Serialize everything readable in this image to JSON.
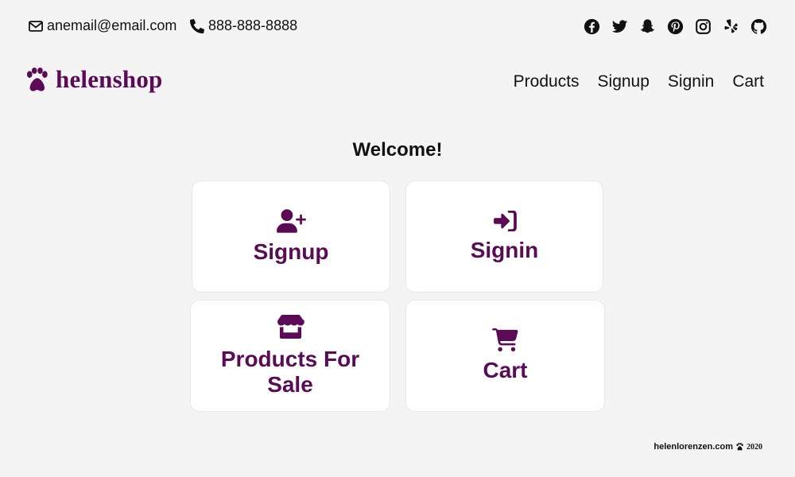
{
  "colors": {
    "brand": "#5b0a56",
    "background": "#f4f4f4",
    "card": "#ffffff",
    "text": "#111111"
  },
  "topbar": {
    "email": "anemail@email.com",
    "phone": "888-888-8888",
    "social_icons": [
      "facebook-icon",
      "twitter-icon",
      "snapchat-icon",
      "pinterest-icon",
      "instagram-icon",
      "yelp-icon",
      "github-icon"
    ]
  },
  "brand": {
    "name": "helenshop",
    "icon": "paw-icon"
  },
  "nav": {
    "items": [
      "Products",
      "Signup",
      "Signin",
      "Cart"
    ]
  },
  "main": {
    "welcome": "Welcome!",
    "cards": [
      {
        "label": "Signup",
        "icon": "user-plus-icon"
      },
      {
        "label": "Signin",
        "icon": "sign-in-icon"
      },
      {
        "label_line1": "Products For",
        "label_line2": "Sale",
        "icon": "store-icon"
      },
      {
        "label": "Cart",
        "icon": "cart-icon"
      }
    ]
  },
  "footer": {
    "site": "helenlorenzen.com",
    "year": "2020"
  }
}
